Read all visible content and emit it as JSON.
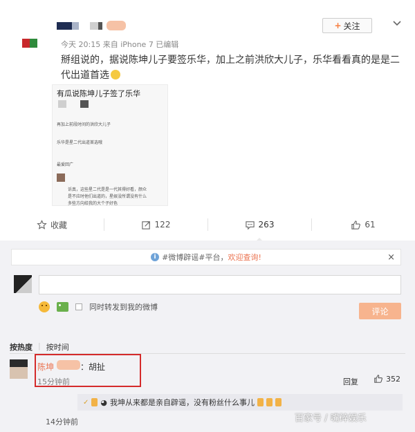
{
  "post": {
    "meta": "今天 20:15 来自 iPhone 7  已编辑",
    "follow_label": "关注",
    "follow_plus": "+",
    "text": "掰组说的，据说陈坤儿子要签乐华，加上之前洪欣大儿子，乐华看看真的是是二代出道首选",
    "embed": {
      "title": "有瓜说陈坤儿子签了乐华",
      "line1": "再加上前段时间的洪欣大儿子",
      "line2": "乐华是星二代出道首选哦",
      "line3": "最爱回广",
      "line4": "诉真，这些星二代是是一代其得好看，颜众",
      "line5": "是不应时他们出道的，星娱没所谓没有什么",
      "line6": "多些方向给我的大个子好色"
    }
  },
  "actions": [
    {
      "label": "收藏",
      "icon": "star-outline-icon"
    },
    {
      "label": "122",
      "icon": "repost-icon"
    },
    {
      "label": "263",
      "icon": "comment-icon"
    },
    {
      "label": "61",
      "icon": "like-icon"
    }
  ],
  "comment_area": {
    "notice_prefix": "#微博辟谣#平台，",
    "notice_link": "欢迎查询!",
    "notice_close": "×",
    "input_value": "",
    "also_repost_label": "同时转发到我的微博",
    "submit_label": "评论",
    "sort_hot": "按热度",
    "sort_sep": "|",
    "sort_time": "按时间"
  },
  "comment": {
    "name": "陈坤",
    "text": "：胡扯",
    "time": "15分钟前",
    "reply_label": "回复",
    "likes": "352"
  },
  "sub_reply": {
    "text": "我坤从来都是亲自辟谣，没有粉丝什么事儿",
    "time": "14分钟前"
  },
  "watermark": "百家号 / 嘴碎娱乐",
  "colors": {
    "accent": "#eb7350",
    "highlight_box": "#d42a2a",
    "submit_disabled": "#f7b48e"
  }
}
